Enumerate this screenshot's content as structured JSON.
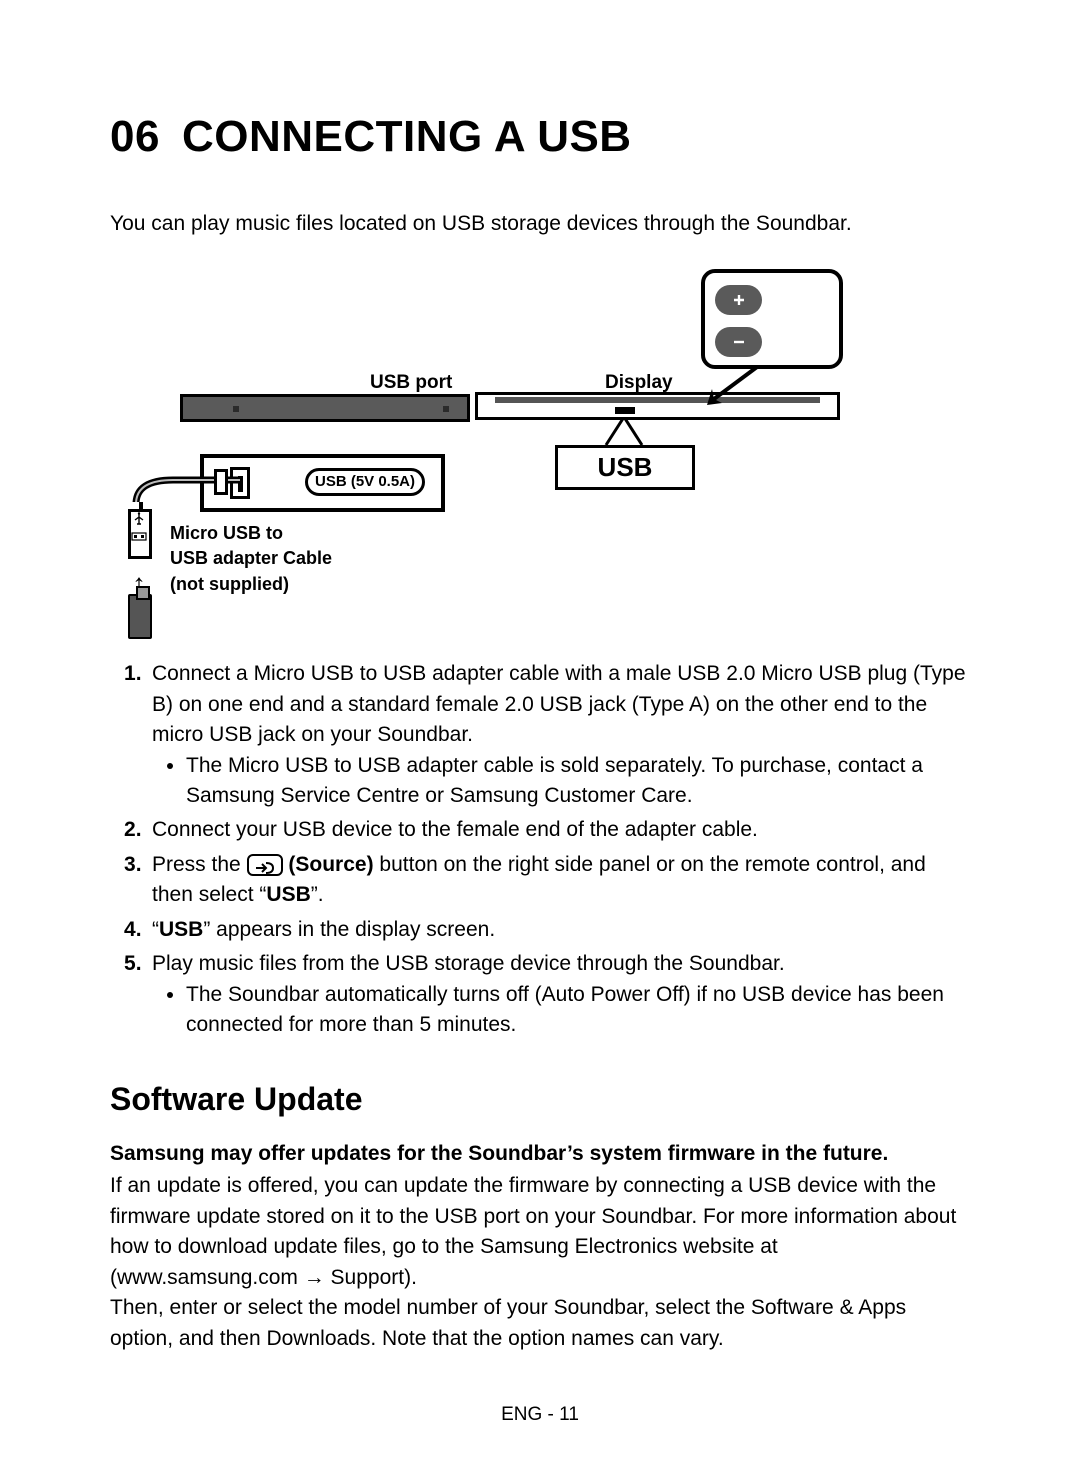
{
  "chapter": {
    "num": "06",
    "title": "CONNECTING A USB"
  },
  "intro": "You can play music files located on USB storage devices through the Soundbar.",
  "diagram": {
    "usb_port_label": "USB port",
    "usb_spec": "USB (5V 0.5A)",
    "adapter_label_l1": "Micro USB to",
    "adapter_label_l2": "USB adapter Cable",
    "adapter_label_l3": "(not supplied)",
    "display_label": "Display",
    "display_callout": "USB"
  },
  "steps": {
    "s1": "Connect a Micro USB to USB adapter cable with a male USB 2.0 Micro USB plug (Type B) on one end and a standard female 2.0 USB jack (Type A) on the other end to the micro USB jack on your Soundbar.",
    "s1_sub1": "The Micro USB to USB adapter cable is sold separately. To purchase, contact a Samsung Service Centre or Samsung Customer Care.",
    "s2": "Connect your USB device to the female end of the adapter cable.",
    "s3_pre": "Press the ",
    "s3_source": "(Source)",
    "s3_post": " button on the right side panel or on the remote control, and then select “",
    "s3_usb": "USB",
    "s3_end": "”.",
    "s4_pre": "“",
    "s4_usb": "USB",
    "s4_post": "” appears in the display screen.",
    "s5": "Play music files from the USB storage device through the Soundbar.",
    "s5_sub1": "The Soundbar automatically turns off (Auto Power Off) if no USB device has been connected for more than 5 minutes."
  },
  "section2": {
    "heading": "Software Update",
    "lead": "Samsung may offer updates for the Soundbar’s system firmware in the future.",
    "p1": "If an update is offered, you can update the firmware by connecting a USB device with the firmware update stored on it to the USB port on your Soundbar. For more information about how to download update files, go to the Samsung Electronics website at (www.samsung.com → Support).",
    "p2": "Then, enter or select the model number of your Soundbar, select the Software & Apps option, and then Downloads. Note that the option names can vary."
  },
  "footer": "ENG - 11"
}
